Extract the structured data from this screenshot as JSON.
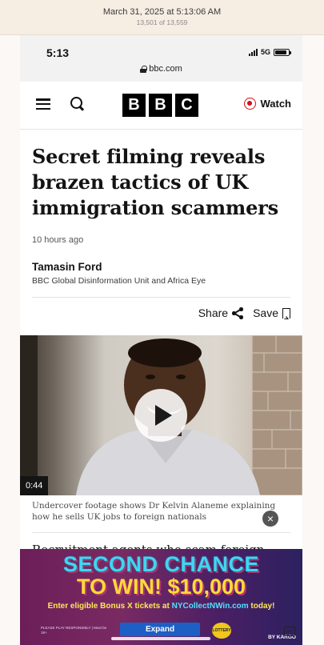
{
  "screenshot": {
    "date": "March 31, 2025 at 5:13:06 AM",
    "count": "13,501 of 13,559"
  },
  "status_bar": {
    "time": "5:13",
    "network": "5G",
    "url": "bbc.com"
  },
  "nav": {
    "logo_letters": [
      "B",
      "B",
      "C"
    ],
    "watch_label": "Watch"
  },
  "article": {
    "headline": "Secret filming reveals brazen tactics of UK immigration scammers",
    "timestamp": "10 hours ago",
    "author": "Tamasin Ford",
    "author_desc": "BBC Global Disinformation Unit and Africa Eye",
    "share_label": "Share",
    "save_label": "Save",
    "video": {
      "duration": "0:44",
      "caption": "Undercover footage shows Dr Kelvin Alaneme explaining how he sells UK jobs to foreign nationals"
    },
    "body_first_line": "Recruitment agents who scam foreign nationals"
  },
  "ad": {
    "line1": "SECOND CHANCE",
    "line2": "TO WIN! $10,000",
    "line3_prefix": "Enter eligible Bonus X tickets at ",
    "line3_link": "NYCollectNWin.com",
    "line3_suffix": " today!",
    "expand_label": "Expand",
    "fine_print": "PLEASE PLAY RESPONSIBLY | Must be 18+",
    "logo_text": "LOTTERY",
    "sponsor": "BY KARGO",
    "close_symbol": "×"
  },
  "colors": {
    "bbc_red": "#d4101c",
    "ad_cyan": "#3fd7f0",
    "ad_yellow": "#ffd93a"
  }
}
